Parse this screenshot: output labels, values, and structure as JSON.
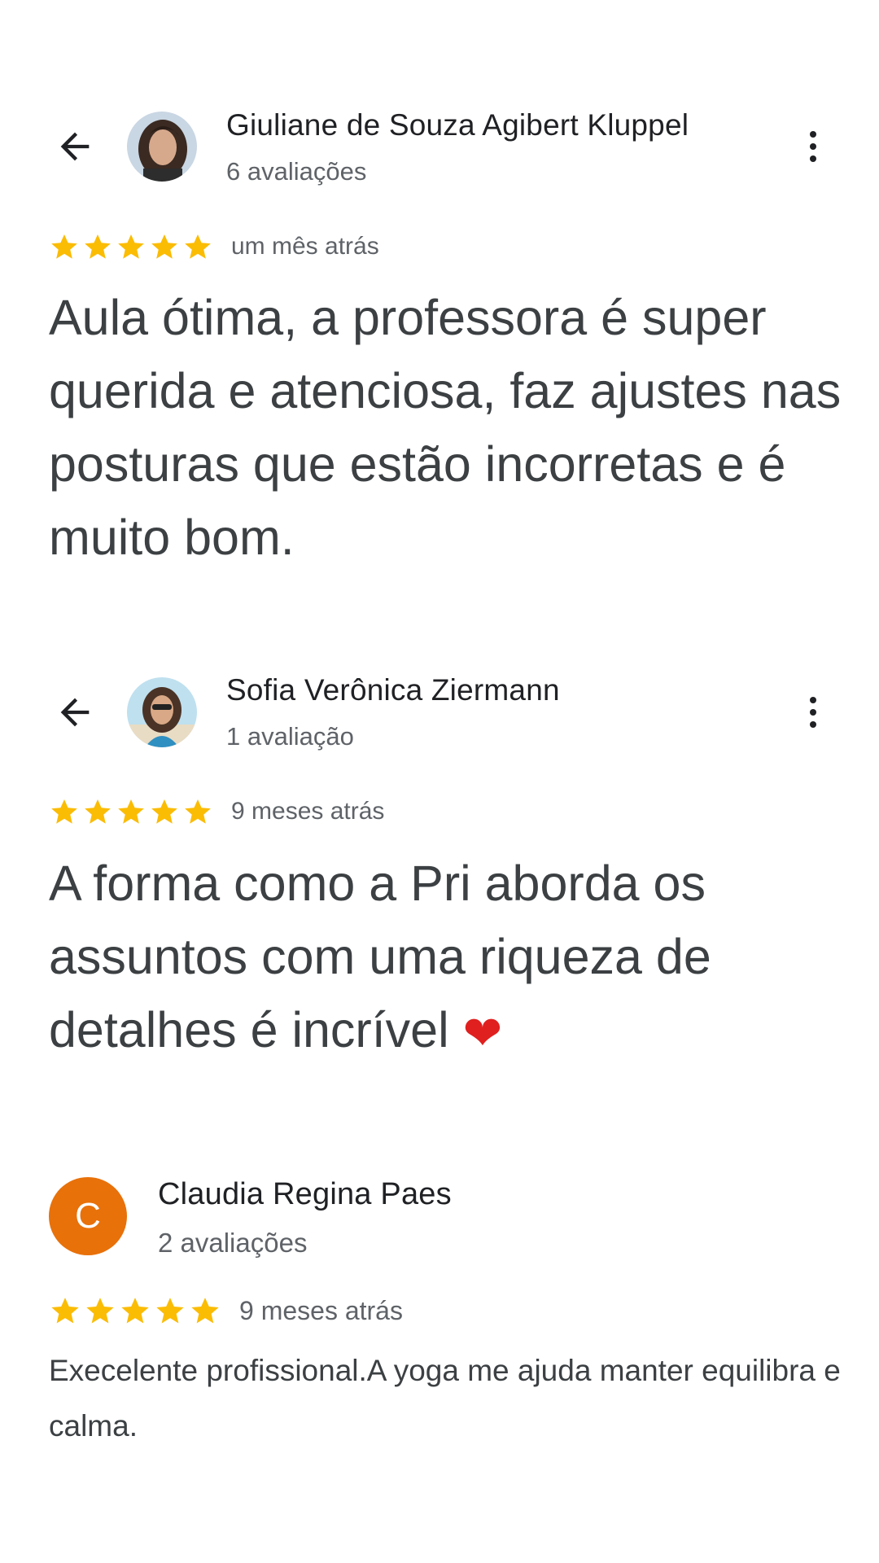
{
  "reviews": [
    {
      "name": "Giuliane de Souza Agibert Kluppel",
      "count": "6 avaliações",
      "rating": 5,
      "time": "um mês atrás",
      "text": "Aula ótima, a professora é super querida e atenciosa, faz ajustes nas posturas que estão incorretas e é muito bom."
    },
    {
      "name": "Sofia Verônica Ziermann",
      "count": "1 avaliação",
      "rating": 5,
      "time": "9 meses atrás",
      "text": "A forma como a Pri aborda os assuntos com uma riqueza de detalhes é incrível",
      "emoji": "❤"
    },
    {
      "name": "Claudia Regina Paes",
      "avatar_letter": "C",
      "count": "2 avaliações",
      "rating": 5,
      "time": "9 meses atrás",
      "text": "Execelente profissional.A yoga me ajuda manter equilibra e calma."
    }
  ],
  "colors": {
    "star": "#fbbc04",
    "avatar_letter_bg": "#e8710a",
    "heart": "#e0201f"
  },
  "icons": {
    "back": "arrow-back-icon",
    "more": "more-vert-icon",
    "star": "star-icon"
  }
}
